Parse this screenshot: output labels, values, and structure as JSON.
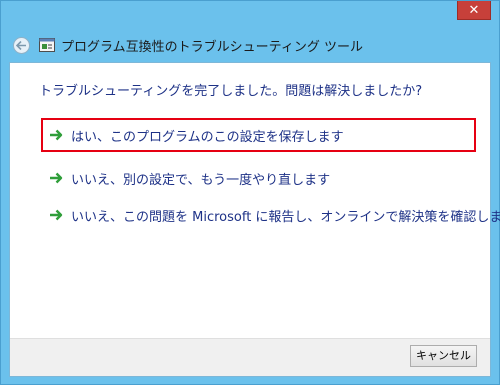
{
  "window": {
    "title": "プログラム互換性のトラブルシューティング ツール",
    "close_label": "✕"
  },
  "icons": {
    "back": "back-arrow-icon",
    "app": "troubleshooter-app-icon",
    "option_arrow": "green-arrow-icon"
  },
  "main": {
    "heading": "トラブルシューティングを完了しました。問題は解決しましたか?",
    "options": [
      {
        "label": "はい、このプログラムのこの設定を保存します",
        "selected": true
      },
      {
        "label": "いいえ、別の設定で、もう一度やり直します",
        "selected": false
      },
      {
        "label": "いいえ、この問題を Microsoft に報告し、オンラインで解決策を確認します",
        "selected": false
      }
    ]
  },
  "footer": {
    "cancel_label": "キャンセル"
  },
  "colors": {
    "chrome": "#6bc1ec",
    "link_text": "#1e3287",
    "highlight_border": "#e60012",
    "close_button": "#c7403a",
    "arrow": "#2f9e3a"
  }
}
